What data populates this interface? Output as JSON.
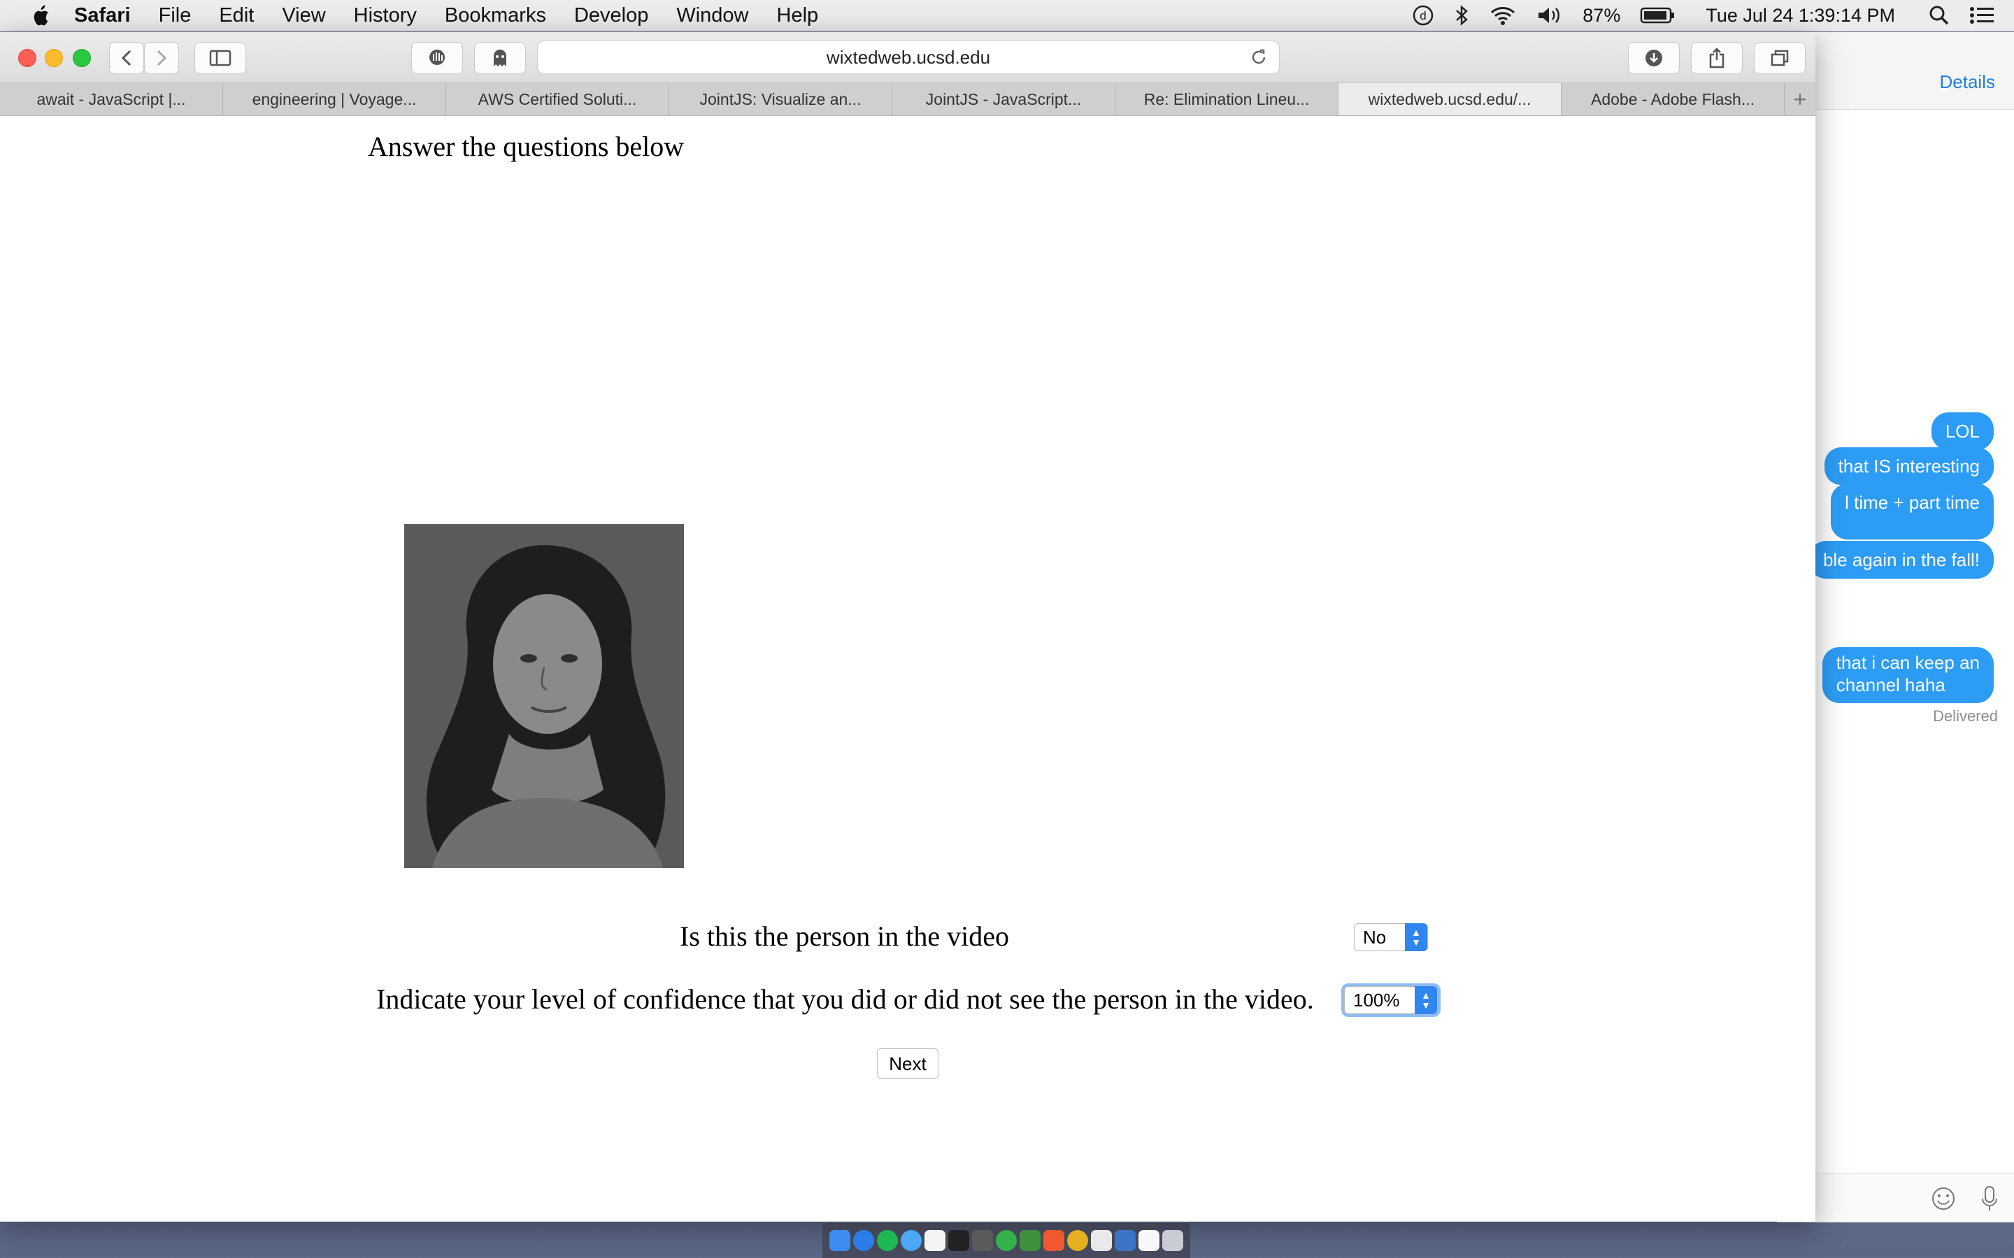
{
  "menubar": {
    "app_name": "Safari",
    "items": [
      "File",
      "Edit",
      "View",
      "History",
      "Bookmarks",
      "Develop",
      "Window",
      "Help"
    ],
    "battery": "87%",
    "datetime": "Tue Jul 24  1:39:14 PM"
  },
  "browser": {
    "url": "wixtedweb.ucsd.edu",
    "tabs": [
      {
        "label": "await - JavaScript |..."
      },
      {
        "label": "engineering | Voyage..."
      },
      {
        "label": "AWS Certified Soluti..."
      },
      {
        "label": "JointJS: Visualize an..."
      },
      {
        "label": "JointJS - JavaScript..."
      },
      {
        "label": "Re: Elimination Lineu..."
      },
      {
        "label": "wixtedweb.ucsd.edu/..."
      },
      {
        "label": "Adobe - Adobe Flash..."
      }
    ],
    "active_tab_index": 6
  },
  "page": {
    "heading": "Answer the questions below",
    "question1": "Is this the person in the video",
    "question1_value": "No",
    "question2": "Indicate your level of confidence that you did or did not see the person in the video.",
    "question2_value": "100%",
    "next_label": "Next"
  },
  "messages": {
    "details_label": "Details",
    "bubbles": [
      {
        "text": "LOL"
      },
      {
        "text": "that IS interesting"
      },
      {
        "text": "l time + part time"
      },
      {
        "text": "ble again in the fall!"
      },
      {
        "text": "that i can keep an"
      },
      {
        "text": "channel haha"
      }
    ],
    "delivered": "Delivered"
  },
  "colors": {
    "accent": "#2f86ee",
    "bubble": "#2d9cf5"
  }
}
